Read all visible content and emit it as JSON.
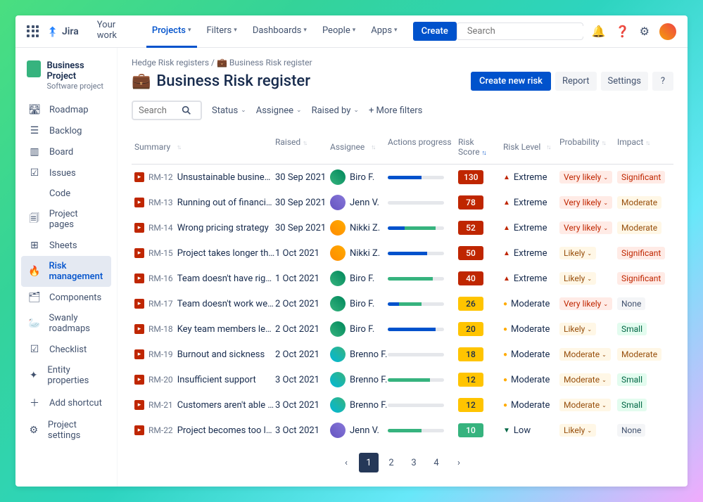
{
  "brand": "Jira",
  "nav": {
    "your_work": "Your work",
    "projects": "Projects",
    "filters": "Filters",
    "dashboards": "Dashboards",
    "people": "People",
    "apps": "Apps",
    "create": "Create"
  },
  "search_placeholder": "Search",
  "project": {
    "name": "Business Project",
    "subtitle": "Software project"
  },
  "sidebar": {
    "items": [
      {
        "label": "Roadmap",
        "icon": "🛣"
      },
      {
        "label": "Backlog",
        "icon": "☰"
      },
      {
        "label": "Board",
        "icon": "▥"
      },
      {
        "label": "Issues",
        "icon": "☑"
      },
      {
        "label": "Code",
        "icon": "</>"
      },
      {
        "label": "Project pages",
        "icon": "🗐"
      },
      {
        "label": "Sheets",
        "icon": "⊞"
      },
      {
        "label": "Risk management",
        "icon": "🔥",
        "active": true
      },
      {
        "label": "Components",
        "icon": "🗂"
      },
      {
        "label": "Swanly roadmaps",
        "icon": "🦢"
      },
      {
        "label": "Checklist",
        "icon": "☑"
      },
      {
        "label": "Entity properties",
        "icon": "✦"
      },
      {
        "label": "Add shortcut",
        "icon": "＋"
      },
      {
        "label": "Project settings",
        "icon": "⚙"
      }
    ]
  },
  "breadcrumb": {
    "parent": "Hedge Risk registers",
    "current": "Business Risk register"
  },
  "page_title": "Business Risk register",
  "actions": {
    "create": "Create new risk",
    "report": "Report",
    "settings": "Settings",
    "help": "?"
  },
  "filters": {
    "search_placeholder": "Search",
    "status": "Status",
    "assignee": "Assignee",
    "raised_by": "Raised by",
    "more": "+ More filters"
  },
  "columns": {
    "summary": "Summary",
    "raised": "Raised",
    "assignee": "Assignee",
    "progress": "Actions progress",
    "score": "Risk Score",
    "level": "Risk Level",
    "prob": "Probability",
    "impact": "Impact"
  },
  "rows": [
    {
      "key": "RM-12",
      "summary": "Unsustainable business model",
      "raised": "30 Sep 2021",
      "assignee": "Biro F.",
      "av": "av1",
      "prog_blue": 60,
      "prog_teal": 0,
      "score": 130,
      "score_cls": "sc-red",
      "level": "Extreme",
      "level_cls": "lvl-red",
      "level_ind": "▲",
      "prob": "Very likely",
      "prob_cls": "tag-red",
      "impact": "Significant",
      "impact_cls": "tag-red"
    },
    {
      "key": "RM-13",
      "summary": "Running out of financial reso…",
      "raised": "30 Sep 2021",
      "assignee": "Jenn V.",
      "av": "av2",
      "prog_blue": 0,
      "prog_teal": 0,
      "score": 78,
      "score_cls": "sc-red",
      "level": "Extreme",
      "level_cls": "lvl-red",
      "level_ind": "▲",
      "prob": "Very likely",
      "prob_cls": "tag-red",
      "impact": "Moderate",
      "impact_cls": "tag-orange"
    },
    {
      "key": "RM-14",
      "summary": "Wrong pricing strategy",
      "raised": "30 Sep 2021",
      "assignee": "Nikki Z.",
      "av": "av3",
      "prog_blue": 30,
      "prog_teal": 55,
      "score": 52,
      "score_cls": "sc-red",
      "level": "Extreme",
      "level_cls": "lvl-red",
      "level_ind": "▲",
      "prob": "Very likely",
      "prob_cls": "tag-red",
      "impact": "Moderate",
      "impact_cls": "tag-orange"
    },
    {
      "key": "RM-15",
      "summary": "Project takes longer then orig…",
      "raised": "1 Oct 2021",
      "assignee": "Nikki Z.",
      "av": "av3",
      "prog_blue": 70,
      "prog_teal": 0,
      "score": 50,
      "score_cls": "sc-red",
      "level": "Extreme",
      "level_cls": "lvl-red",
      "level_ind": "▲",
      "prob": "Likely",
      "prob_cls": "tag-orange",
      "impact": "Significant",
      "impact_cls": "tag-red"
    },
    {
      "key": "RM-16",
      "summary": "Team doesn't have right skillset",
      "raised": "1 Oct 2021",
      "assignee": "Biro F.",
      "av": "av1",
      "prog_blue": 0,
      "prog_teal": 80,
      "score": 40,
      "score_cls": "sc-red",
      "level": "Extreme",
      "level_cls": "lvl-red",
      "level_ind": "▲",
      "prob": "Likely",
      "prob_cls": "tag-orange",
      "impact": "Significant",
      "impact_cls": "tag-red"
    },
    {
      "key": "RM-17",
      "summary": "Team doesn't work well toget…",
      "raised": "2 Oct 2021",
      "assignee": "Biro F.",
      "av": "av1",
      "prog_blue": 20,
      "prog_teal": 40,
      "score": 26,
      "score_cls": "sc-yellow",
      "level": "Moderate",
      "level_cls": "lvl-yellow",
      "level_ind": "●",
      "prob": "Very likely",
      "prob_cls": "tag-red",
      "impact": "None",
      "impact_cls": "tag-gray"
    },
    {
      "key": "RM-18",
      "summary": "Key team members leave",
      "raised": "2 Oct 2021",
      "assignee": "Biro F.",
      "av": "av1",
      "prog_blue": 85,
      "prog_teal": 0,
      "score": 20,
      "score_cls": "sc-yellow",
      "level": "Moderate",
      "level_cls": "lvl-yellow",
      "level_ind": "●",
      "prob": "Likely",
      "prob_cls": "tag-orange",
      "impact": "Small",
      "impact_cls": "tag-green"
    },
    {
      "key": "RM-19",
      "summary": "Burnout and sickness",
      "raised": "2 Oct 2021",
      "assignee": "Brenno F.",
      "av": "av4",
      "prog_blue": 0,
      "prog_teal": 0,
      "score": 18,
      "score_cls": "sc-yellow",
      "level": "Moderate",
      "level_cls": "lvl-yellow",
      "level_ind": "●",
      "prob": "Moderate",
      "prob_cls": "tag-orange",
      "impact": "Moderate",
      "impact_cls": "tag-orange"
    },
    {
      "key": "RM-20",
      "summary": "Insufficient support",
      "raised": "3 Oct 2021",
      "assignee": "Brenno F.",
      "av": "av4",
      "prog_blue": 0,
      "prog_teal": 75,
      "score": 12,
      "score_cls": "sc-yellow",
      "level": "Moderate",
      "level_cls": "lvl-yellow",
      "level_ind": "●",
      "prob": "Moderate",
      "prob_cls": "tag-orange",
      "impact": "Small",
      "impact_cls": "tag-green"
    },
    {
      "key": "RM-21",
      "summary": "Customers aren't able to ado…",
      "raised": "3 Oct 2021",
      "assignee": "Brenno F.",
      "av": "av4",
      "prog_blue": 0,
      "prog_teal": 0,
      "score": 12,
      "score_cls": "sc-yellow",
      "level": "Moderate",
      "level_cls": "lvl-yellow",
      "level_ind": "●",
      "prob": "Moderate",
      "prob_cls": "tag-orange",
      "impact": "Small",
      "impact_cls": "tag-green"
    },
    {
      "key": "RM-22",
      "summary": "Project becomes too large an…",
      "raised": "3 Oct 2021",
      "assignee": "Jenn V.",
      "av": "av2",
      "prog_blue": 0,
      "prog_teal": 60,
      "score": 10,
      "score_cls": "sc-green",
      "level": "Low",
      "level_cls": "lvl-green",
      "level_ind": "▼",
      "prob": "Likely",
      "prob_cls": "tag-orange",
      "impact": "None",
      "impact_cls": "tag-gray"
    }
  ],
  "pagination": {
    "pages": [
      "1",
      "2",
      "3",
      "4"
    ],
    "current": 1
  }
}
